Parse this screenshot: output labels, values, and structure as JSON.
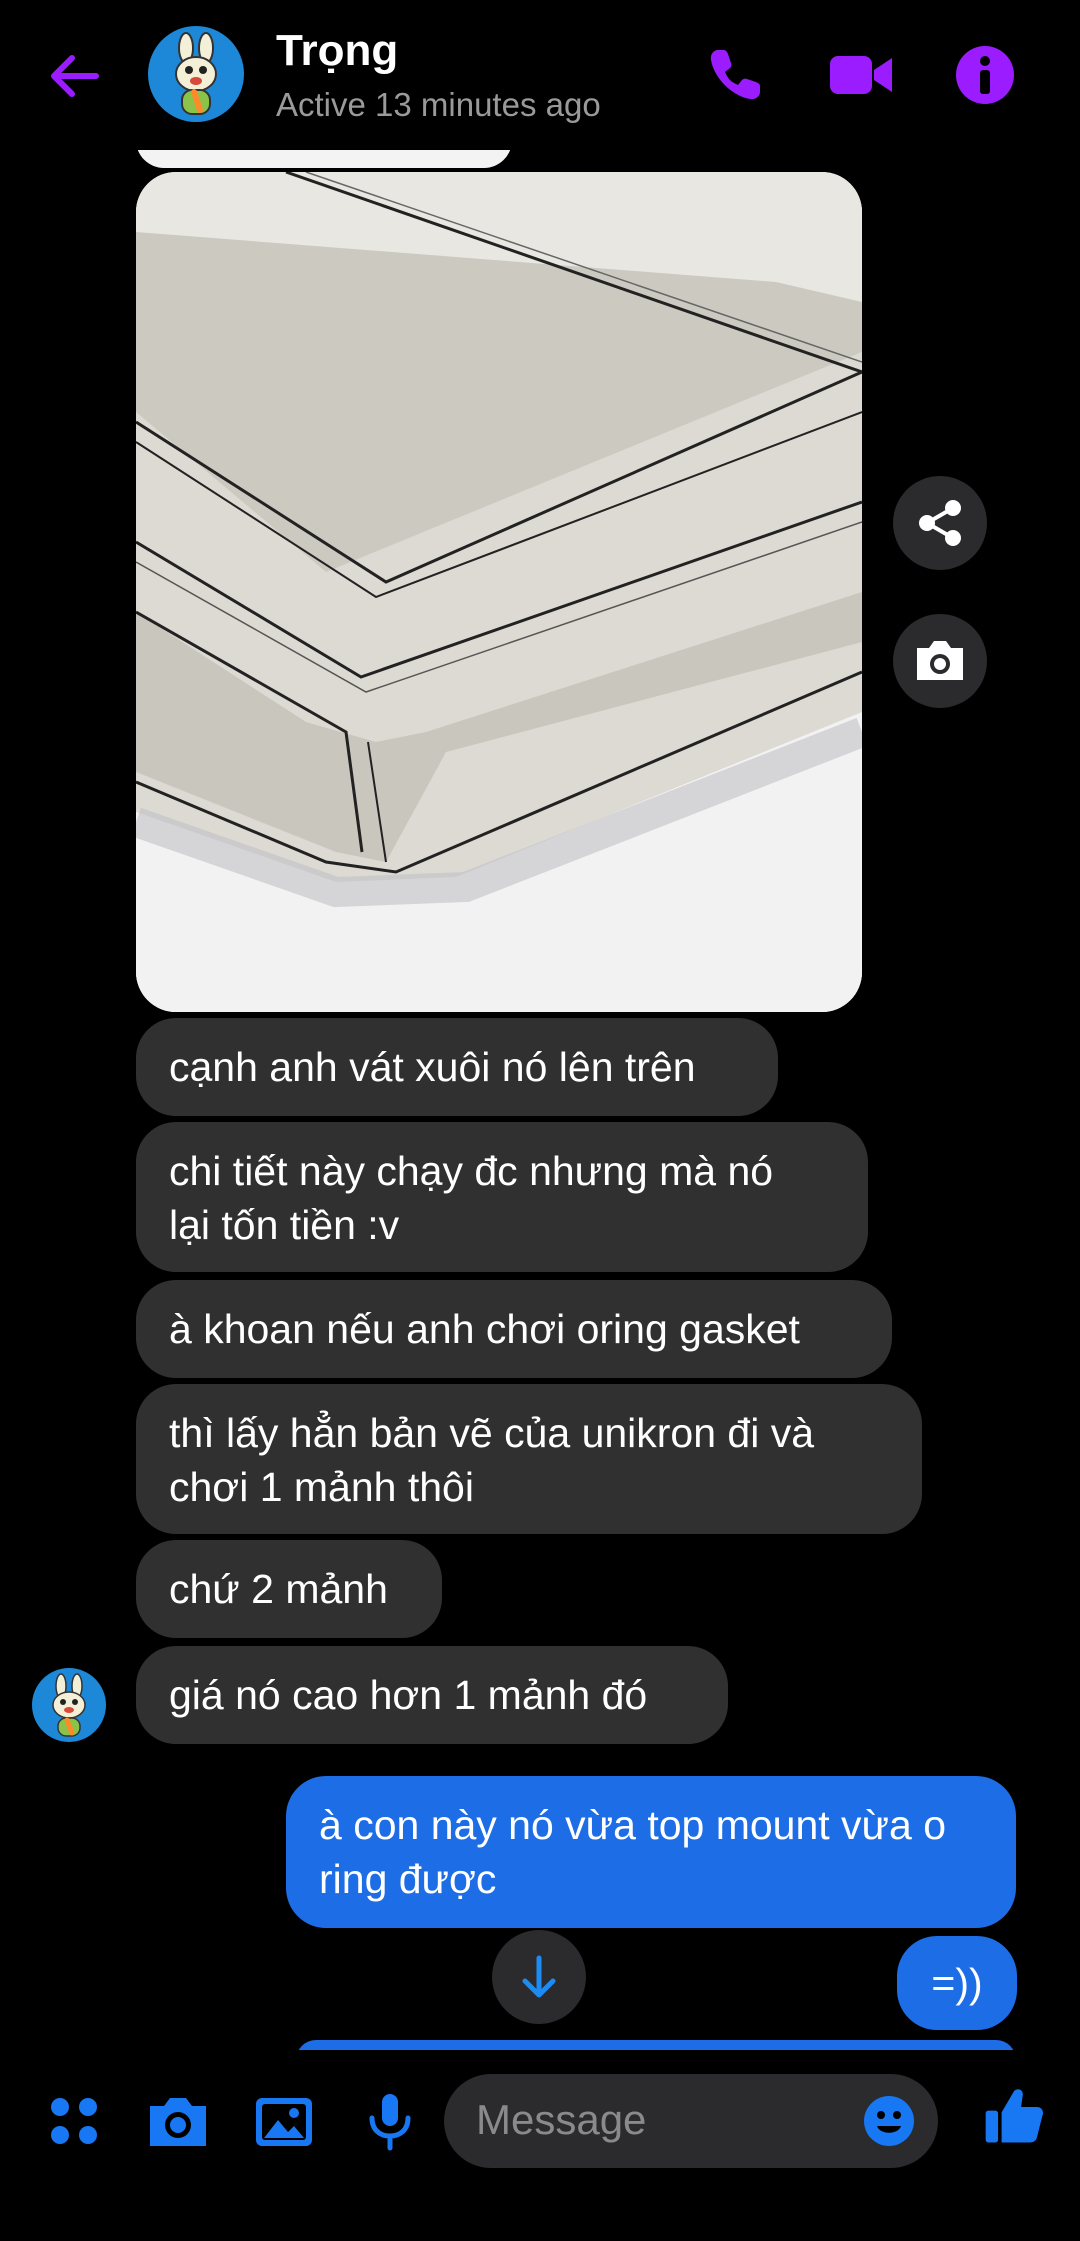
{
  "header": {
    "name": "Trọng",
    "status": "Active 13 minutes ago"
  },
  "messages_in": [
    "cạnh anh vát xuôi nó lên trên",
    "chi tiết này chạy đc nhưng mà nó\nlại tốn tiền :v",
    "à khoan nếu anh chơi oring gasket",
    "thì lấy hẳn bản vẽ của unikron đi và\nchơi 1 mảnh thôi",
    "chứ 2 mảnh",
    "giá nó cao hơn 1 mảnh đó"
  ],
  "messages_out": [
    "à con này nó vừa top mount vừa o ring được",
    "=))"
  ],
  "composer": {
    "placeholder": "Message"
  },
  "colors": {
    "accent": "#9b1cff",
    "outgoing": "#1c6de6",
    "incoming": "#303030",
    "toolbar_icon": "#1877f2"
  }
}
